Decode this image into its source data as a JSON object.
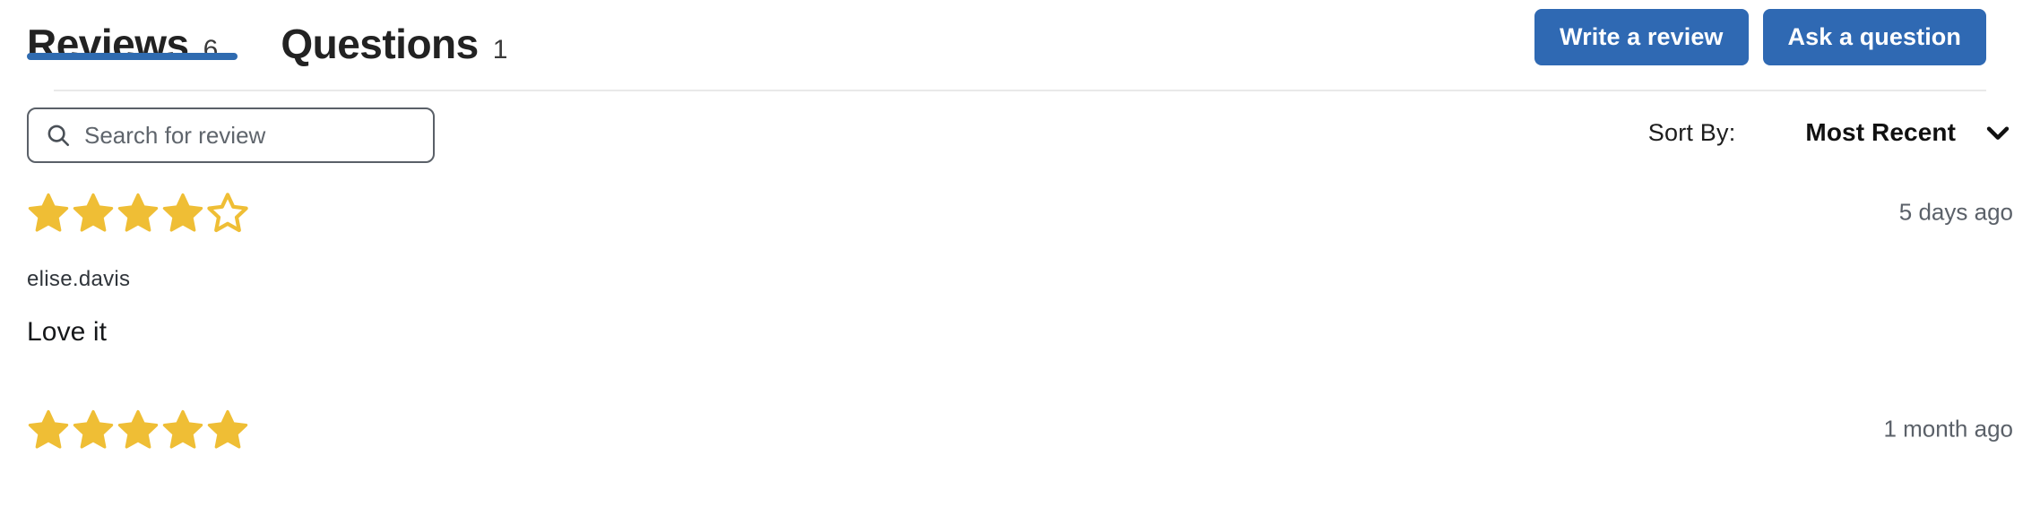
{
  "tabs": [
    {
      "label": "Reviews",
      "count": "6",
      "active": true
    },
    {
      "label": "Questions",
      "count": "1",
      "active": false
    }
  ],
  "header_actions": {
    "write_review_label": "Write a review",
    "ask_question_label": "Ask a question"
  },
  "filters": {
    "search_placeholder": "Search for review",
    "search_value": "",
    "search_icon": "search-icon",
    "sort_label": "Sort By:",
    "sort_value": "Most Recent",
    "sort_chevron_icon": "chevron-down-icon"
  },
  "reviews": [
    {
      "rating": 4,
      "max_rating": 5,
      "date": "5 days ago",
      "author": "elise.davis",
      "body": "Love it"
    },
    {
      "rating": 5,
      "max_rating": 5,
      "date": "1 month ago",
      "author": "",
      "body": ""
    }
  ],
  "colors": {
    "accent_blue": "#2f69b3",
    "tab_underline": "#2f6bb0",
    "star_filled": "#efbe35",
    "star_empty_stroke": "#efbe35",
    "divider": "#e9e9e9"
  }
}
